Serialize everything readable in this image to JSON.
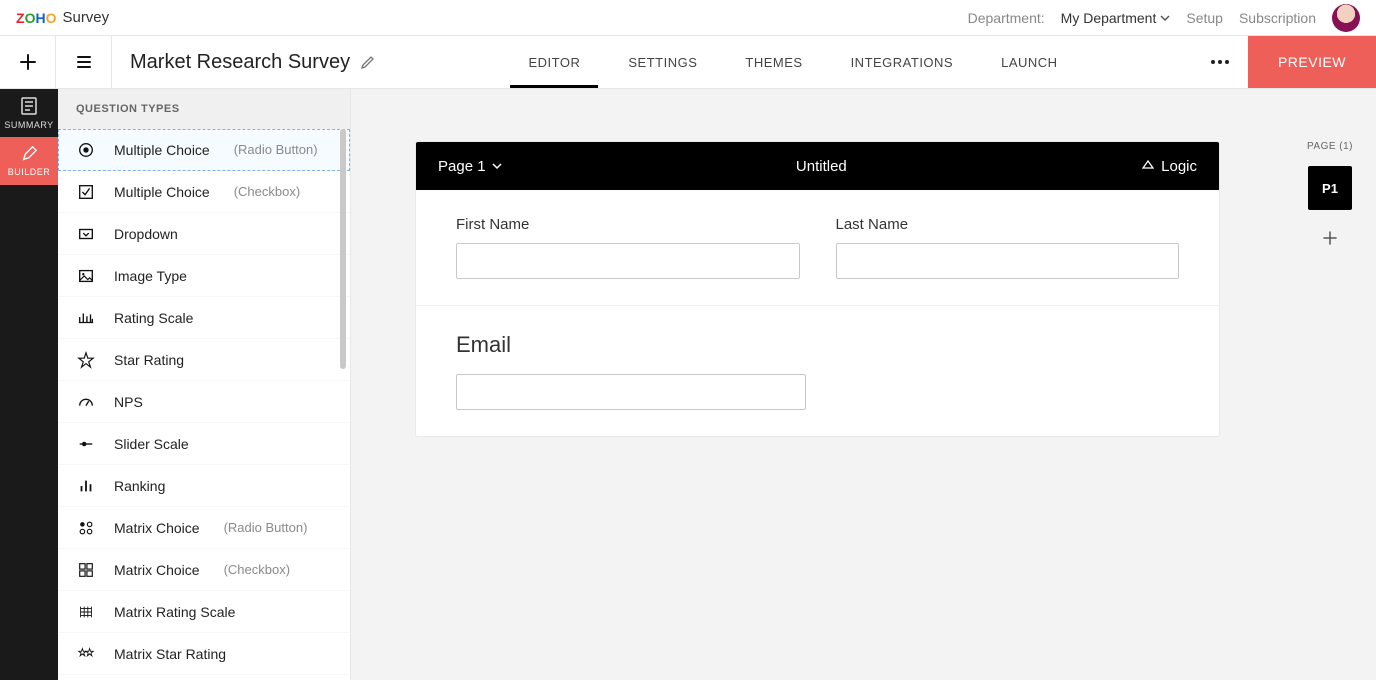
{
  "brand": {
    "survey": "Survey"
  },
  "header": {
    "department_label": "Department:",
    "department_value": "My Department",
    "setup": "Setup",
    "subscription": "Subscription"
  },
  "title": "Market Research Survey",
  "tabs": {
    "editor": "EDITOR",
    "settings": "SETTINGS",
    "themes": "THEMES",
    "integrations": "INTEGRATIONS",
    "launch": "LAUNCH"
  },
  "preview_label": "PREVIEW",
  "rail": {
    "summary": "SUMMARY",
    "builder": "BUILDER"
  },
  "qp": {
    "header": "QUESTION TYPES",
    "items": [
      {
        "label": "Multiple Choice",
        "sub": "(Radio Button)"
      },
      {
        "label": "Multiple Choice",
        "sub": "(Checkbox)"
      },
      {
        "label": "Dropdown",
        "sub": ""
      },
      {
        "label": "Image Type",
        "sub": ""
      },
      {
        "label": "Rating Scale",
        "sub": ""
      },
      {
        "label": "Star Rating",
        "sub": ""
      },
      {
        "label": "NPS",
        "sub": ""
      },
      {
        "label": "Slider Scale",
        "sub": ""
      },
      {
        "label": "Ranking",
        "sub": ""
      },
      {
        "label": "Matrix Choice",
        "sub": "(Radio Button)"
      },
      {
        "label": "Matrix Choice",
        "sub": "(Checkbox)"
      },
      {
        "label": "Matrix Rating Scale",
        "sub": ""
      },
      {
        "label": "Matrix Star Rating",
        "sub": ""
      }
    ]
  },
  "page": {
    "selector_label": "Page 1",
    "title": "Untitled",
    "logic_label": "Logic",
    "fields": {
      "first_name_label": "First Name",
      "last_name_label": "Last Name",
      "email_label": "Email"
    },
    "rail_label": "PAGE (1)",
    "thumb_label": "P1"
  }
}
